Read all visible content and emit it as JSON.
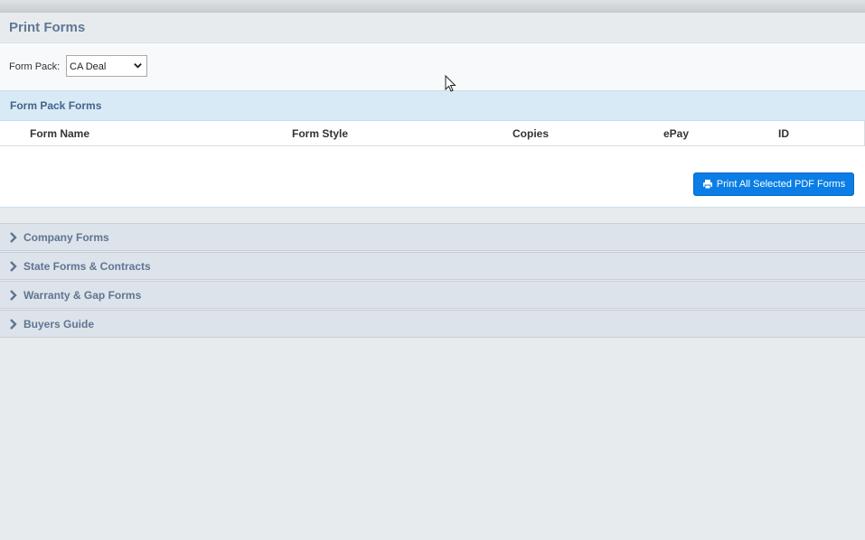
{
  "page": {
    "title": "Print Forms"
  },
  "form_pack": {
    "label": "Form Pack:",
    "selected": "CA Deal"
  },
  "form_pack_forms": {
    "title": "Form Pack Forms",
    "columns": [
      "Form Name",
      "Form Style",
      "Copies",
      "ePay",
      "ID"
    ],
    "print_button_label": "Print All Selected PDF Forms"
  },
  "accordion": [
    {
      "label": "Company Forms"
    },
    {
      "label": "State Forms & Contracts"
    },
    {
      "label": "Warranty & Gap Forms"
    },
    {
      "label": "Buyers Guide"
    }
  ],
  "colors": {
    "accent": "#0a7ee6",
    "section_bg": "#d9eaf7",
    "accordion_bg": "#dde3ea",
    "title_text": "#5d7895"
  },
  "icons": {
    "select": "chevron-down-icon",
    "print": "printer-icon",
    "accordion": "chevron-right-icon",
    "cursor": "mouse-pointer-icon"
  }
}
